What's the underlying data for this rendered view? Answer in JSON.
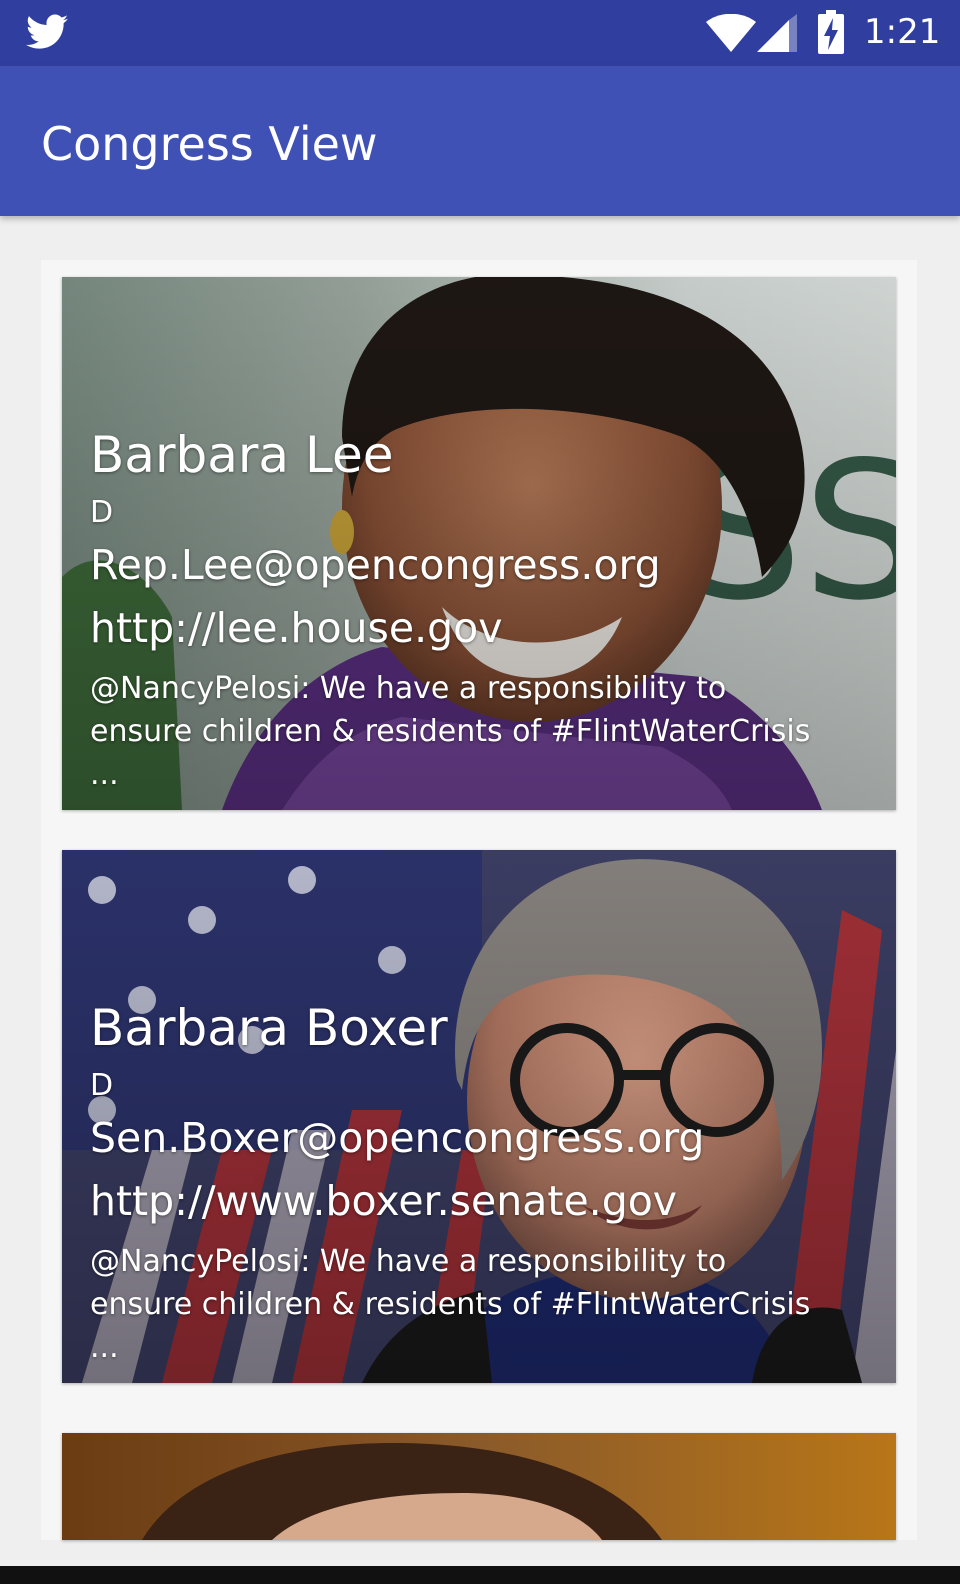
{
  "status_bar": {
    "time": "1:21",
    "icons": [
      "twitter-icon",
      "wifi-icon",
      "signal-icon",
      "battery-charging-icon"
    ]
  },
  "app_bar": {
    "title": "Congress View"
  },
  "members": [
    {
      "name": "Barbara Lee",
      "party": "D",
      "email": "Rep.Lee@opencongress.org",
      "website": "http://lee.house.gov",
      "tweet": "@NancyPelosi: We have a responsibility to ensure children & residents of #FlintWaterCrisis ..."
    },
    {
      "name": "Barbara Boxer",
      "party": "D",
      "email": "Sen.Boxer@opencongress.org",
      "website": "http://www.boxer.senate.gov",
      "tweet": "@NancyPelosi: We have a responsibility to ensure children & residents of #FlintWaterCrisis ..."
    }
  ],
  "colors": {
    "status_bar": "#303f9f",
    "app_bar": "#3f51b5",
    "background": "#efefef"
  }
}
